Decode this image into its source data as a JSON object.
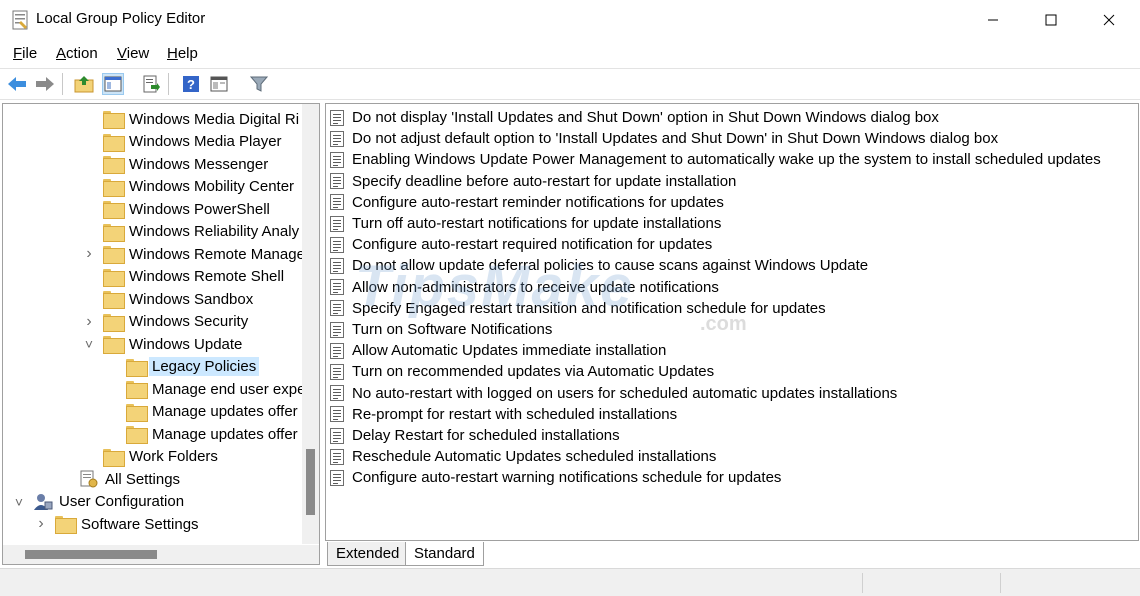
{
  "window": {
    "title": "Local Group Policy Editor",
    "controls": [
      "minimize",
      "maximize",
      "close"
    ]
  },
  "menu": {
    "items": [
      {
        "label": "File",
        "underline": "F"
      },
      {
        "label": "Action",
        "underline": "A"
      },
      {
        "label": "View",
        "underline": "V"
      },
      {
        "label": "Help",
        "underline": "H"
      }
    ]
  },
  "toolbar": {
    "buttons": [
      "back-icon",
      "forward-icon",
      "up-folder-icon",
      "show-hide-tree-icon",
      "export-list-icon",
      "help-icon",
      "properties-icon",
      "filter-icon"
    ]
  },
  "tree": {
    "items": [
      {
        "label": "Windows Media Digital Ri",
        "level": 1,
        "expander": ""
      },
      {
        "label": "Windows Media Player",
        "level": 1,
        "expander": ""
      },
      {
        "label": "Windows Messenger",
        "level": 1,
        "expander": ""
      },
      {
        "label": "Windows Mobility Center",
        "level": 1,
        "expander": ""
      },
      {
        "label": "Windows PowerShell",
        "level": 1,
        "expander": ""
      },
      {
        "label": "Windows Reliability Analy",
        "level": 1,
        "expander": ""
      },
      {
        "label": "Windows Remote Manage",
        "level": 1,
        "expander": ">"
      },
      {
        "label": "Windows Remote Shell",
        "level": 1,
        "expander": ""
      },
      {
        "label": "Windows Sandbox",
        "level": 1,
        "expander": ""
      },
      {
        "label": "Windows Security",
        "level": 1,
        "expander": ">"
      },
      {
        "label": "Windows Update",
        "level": 1,
        "expander": "v"
      },
      {
        "label": "Legacy Policies",
        "level": 2,
        "expander": "",
        "selected": true
      },
      {
        "label": "Manage end user expe",
        "level": 2,
        "expander": ""
      },
      {
        "label": "Manage updates offer",
        "level": 2,
        "expander": ""
      },
      {
        "label": "Manage updates offer",
        "level": 2,
        "expander": ""
      },
      {
        "label": "Work Folders",
        "level": 1,
        "expander": ""
      },
      {
        "label": "All Settings",
        "level": 0,
        "expander": "",
        "icon": "settings"
      },
      {
        "label": "User Configuration",
        "level": -1,
        "expander": "v",
        "icon": "user"
      },
      {
        "label": "Software Settings",
        "level": -0.5,
        "expander": ">"
      }
    ]
  },
  "policies": {
    "items": [
      "Do not display 'Install Updates and Shut Down' option in Shut Down Windows dialog box",
      "Do not adjust default option to 'Install Updates and Shut Down' in Shut Down Windows dialog box",
      "Enabling Windows Update Power Management to automatically wake up the system to install scheduled updates",
      "Specify deadline before auto-restart for update installation",
      "Configure auto-restart reminder notifications for updates",
      "Turn off auto-restart notifications for update installations",
      "Configure auto-restart required notification for updates",
      "Do not allow update deferral policies to cause scans against Windows Update",
      "Allow non-administrators to receive update notifications",
      "Specify Engaged restart transition and notification schedule for updates",
      "Turn on Software Notifications",
      "Allow Automatic Updates immediate installation",
      "Turn on recommended updates via Automatic Updates",
      "No auto-restart with logged on users for scheduled automatic updates installations",
      "Re-prompt for restart with scheduled installations",
      "Delay Restart for scheduled installations",
      "Reschedule Automatic Updates scheduled installations",
      "Configure auto-restart warning notifications schedule for updates"
    ]
  },
  "tabs": {
    "extended": "Extended",
    "standard": "Standard"
  },
  "watermark": {
    "text": "TipsMake",
    "suffix": ".com"
  }
}
